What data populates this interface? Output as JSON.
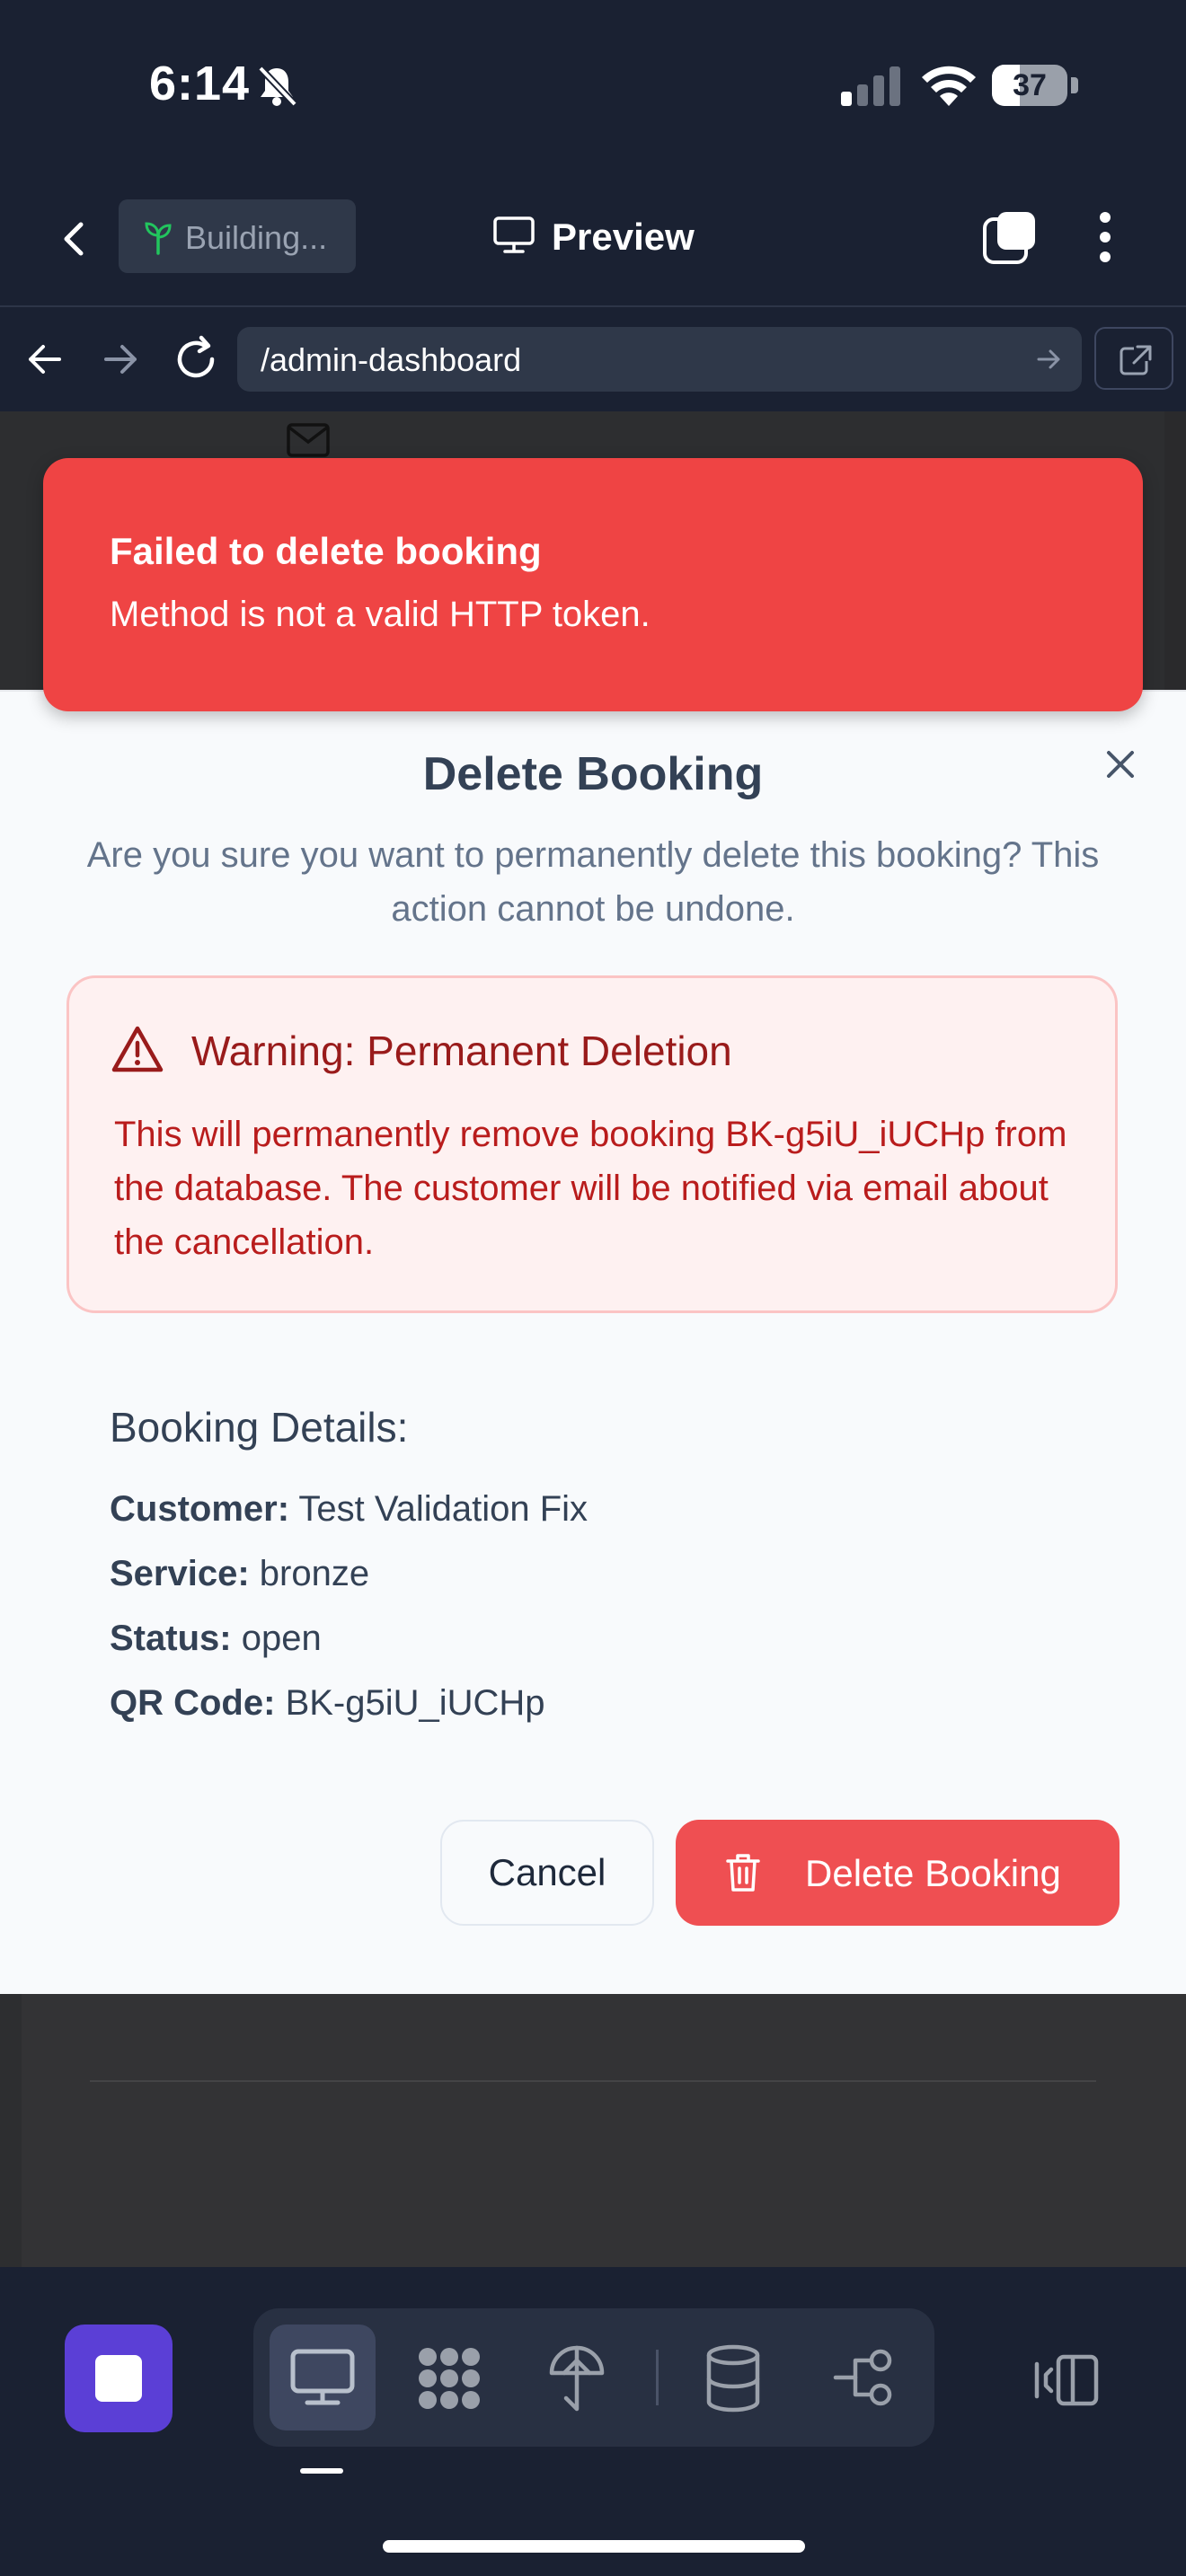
{
  "status_bar": {
    "time": "6:14",
    "battery": "37",
    "battery_level": 0.37
  },
  "header": {
    "building_label": "Building...",
    "preview_label": "Preview"
  },
  "browser": {
    "url": "/admin-dashboard"
  },
  "toast": {
    "title": "Failed to delete booking",
    "message": "Method is not a valid HTTP token."
  },
  "modal": {
    "title": "Delete Booking",
    "description": "Are you sure you want to permanently delete this booking? This action cannot be undone.",
    "warning": {
      "title": "Warning: Permanent Deletion",
      "text": "This will permanently remove booking BK-g5iU_iUCHp from the database. The customer will be notified via email about the cancellation."
    },
    "details": {
      "title": "Booking Details:",
      "rows": [
        {
          "label": "Customer:",
          "value": "Test Validation Fix"
        },
        {
          "label": "Service:",
          "value": "bronze"
        },
        {
          "label": "Status:",
          "value": "open"
        },
        {
          "label": "QR Code:",
          "value": "BK-g5iU_iUCHp"
        }
      ]
    },
    "cancel_label": "Cancel",
    "delete_label": "Delete Booking"
  },
  "colors": {
    "danger": "#ef4444",
    "accent": "#5b3fd6",
    "chrome": "#1a2132"
  },
  "icons": [
    "bell-slash-icon",
    "signal-icon",
    "wifi-icon",
    "battery-icon",
    "back-chevron-icon",
    "sprout-icon",
    "monitor-icon",
    "tabs-icon",
    "more-vertical-icon",
    "arrow-left-icon",
    "arrow-right-icon",
    "reload-icon",
    "external-link-icon",
    "mail-icon",
    "close-icon",
    "warning-triangle-icon",
    "trash-icon",
    "stop-icon",
    "grid-icon",
    "deploy-icon",
    "database-icon",
    "workflow-icon",
    "panel-icon"
  ]
}
